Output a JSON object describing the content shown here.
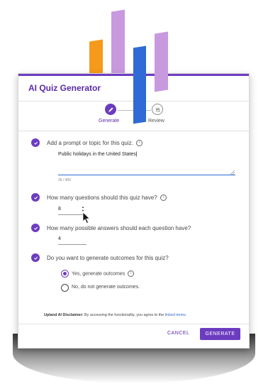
{
  "dialog": {
    "title": "AI Quiz Generator"
  },
  "stepper": {
    "steps": [
      {
        "label": "Generate",
        "state": "active"
      },
      {
        "label": "Review",
        "state": "inactive"
      }
    ]
  },
  "questions": {
    "prompt": {
      "label": "Add a prompt or topic for this quiz.",
      "value": "Public holidays in the United States",
      "counter": "36 / 400"
    },
    "question_count": {
      "label": "How many questions should this quiz have?",
      "value": "8"
    },
    "answer_count": {
      "label": "How many possible answers should each question have?",
      "value": "4"
    },
    "outcomes": {
      "label": "Do you want to generate outcomes for this quiz?",
      "options": [
        {
          "label": "Yes, generate outcomes",
          "selected": true
        },
        {
          "label": "No, do not generate outcomes.",
          "selected": false
        }
      ]
    }
  },
  "disclaimer": {
    "bold": "Upland AI Disclaimer:",
    "text": " By accessing the functionality, you agree to the ",
    "link": "linked terms",
    "end": "."
  },
  "footer": {
    "cancel_label": "CANCEL",
    "generate_label": "GENERATE"
  },
  "colors": {
    "accent": "#6c3cc0",
    "link": "#2f6ad6",
    "decor_orange": "#f59a1b",
    "decor_lilac": "#c999e0",
    "decor_blue": "#2f6ad6"
  }
}
